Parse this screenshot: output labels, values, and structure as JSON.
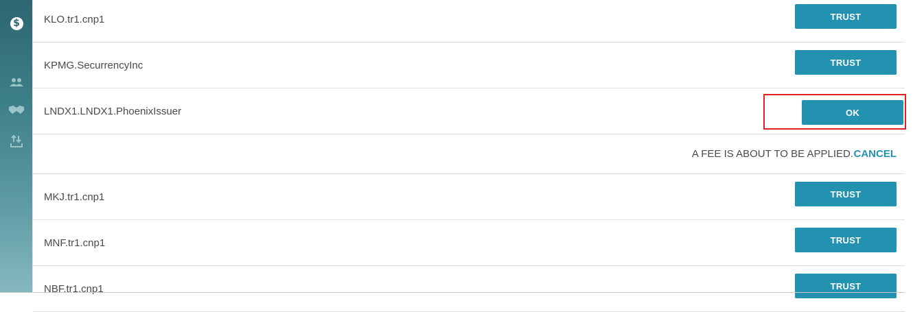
{
  "sidebar": {
    "icons": [
      "dollar-icon",
      "users-icon",
      "handshake-icon",
      "transfer-icon"
    ],
    "dollar_symbol": "$"
  },
  "rows": [
    {
      "name": "KLO.tr1.cnp1",
      "action": "TRUST"
    },
    {
      "name": "KPMG.SecurrencyInc",
      "action": "TRUST"
    },
    {
      "name": "LNDX1.LNDX1.PhoenixIssuer",
      "action": "OK"
    },
    {
      "name": "MKJ.tr1.cnp1",
      "action": "TRUST"
    },
    {
      "name": "MNF.tr1.cnp1",
      "action": "TRUST"
    },
    {
      "name": "NBF.tr1.cnp1",
      "action": "TRUST"
    }
  ],
  "fee_notice": {
    "text": "A FEE IS ABOUT TO BE APPLIED.",
    "cancel_label": "CANCEL"
  },
  "colors": {
    "accent": "#2391b0",
    "highlight": "#e02020",
    "sidebar_top": "#2d6670",
    "sidebar_bottom": "#86b9bf"
  }
}
